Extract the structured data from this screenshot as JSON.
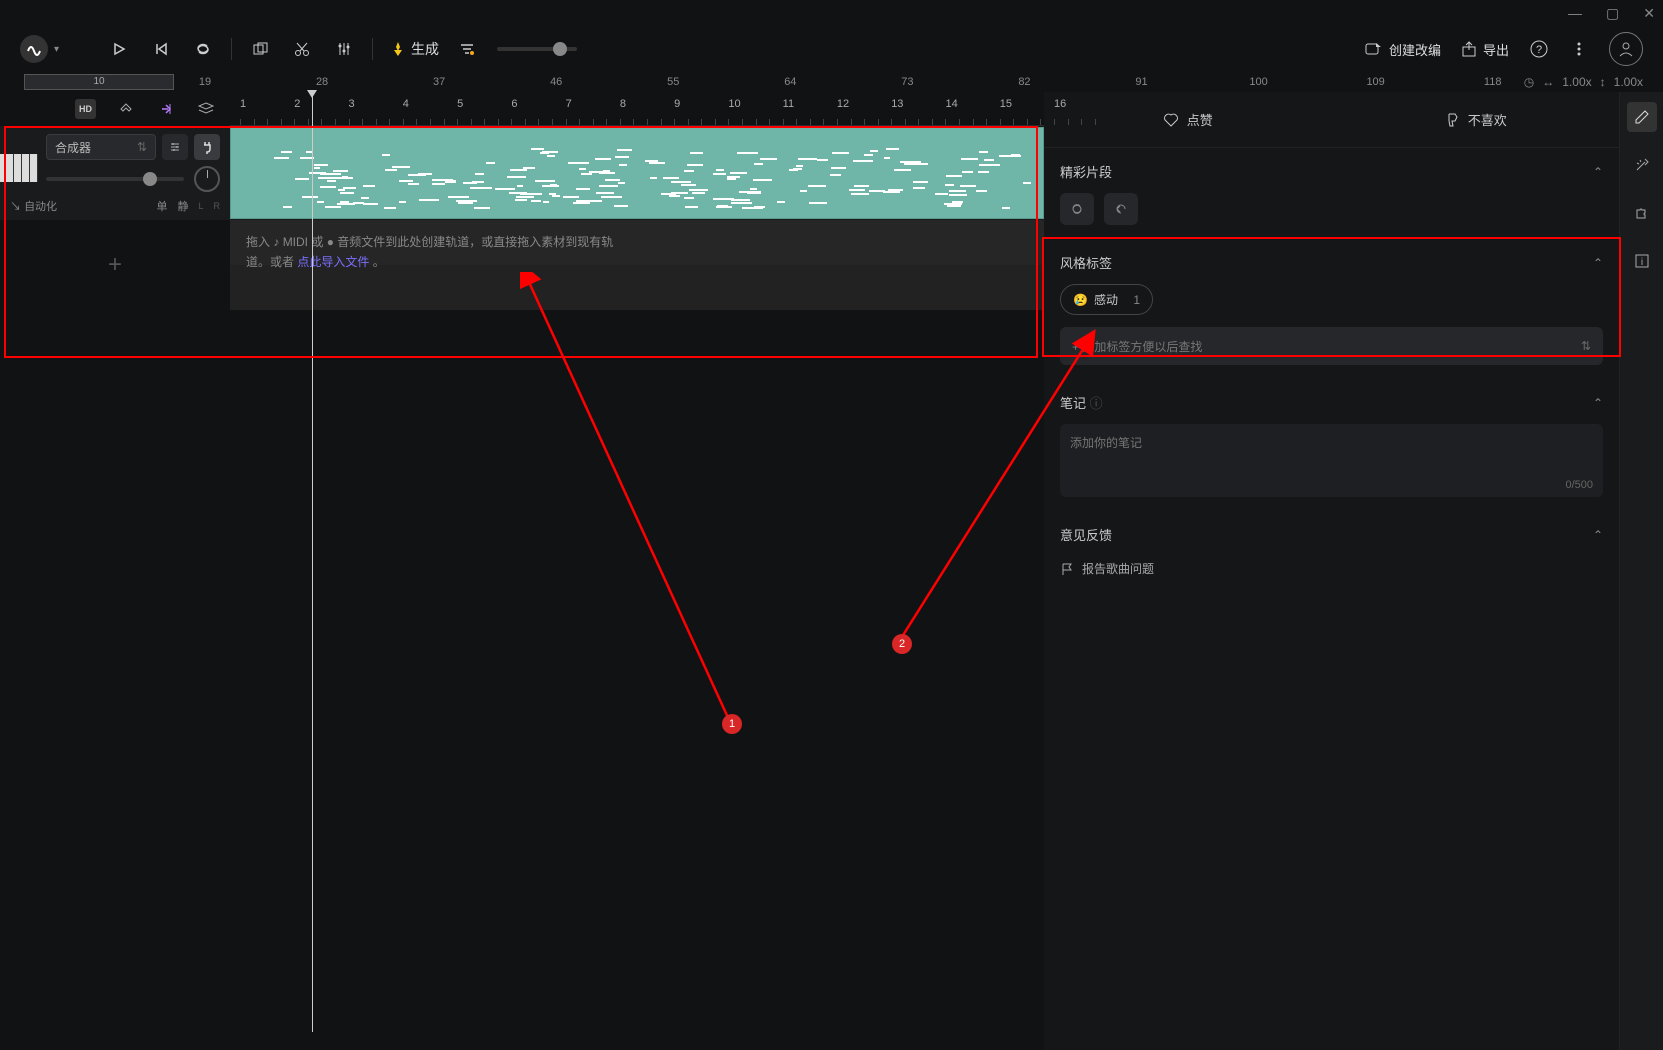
{
  "titlebar": {
    "minimize": "—",
    "maximize": "▢",
    "close": "✕"
  },
  "toolbar": {
    "generate_label": "生成",
    "create_edit": "创建改编",
    "export": "导出"
  },
  "ruler_top": {
    "start": "10",
    "numbers": [
      "19",
      "28",
      "37",
      "46",
      "55",
      "64",
      "73",
      "82",
      "91",
      "100",
      "109",
      "118"
    ]
  },
  "zoom": {
    "h": "1.00x",
    "v": "1.00x"
  },
  "ruler_marks": [
    "1",
    "2",
    "3",
    "4",
    "5",
    "6",
    "7",
    "8",
    "9",
    "10",
    "11",
    "12",
    "13",
    "14",
    "15",
    "16"
  ],
  "track": {
    "instrument": "合成器",
    "automation": "自动化",
    "solo": "单",
    "mute": "静",
    "lr_l": "L",
    "lr_r": "R"
  },
  "dropzone": {
    "prefix": "拖入 ",
    "midi": "MIDI",
    "or": " 或 ",
    "suffix1": " 音频文件到此处创建轨道，或直接拖入素材到现有轨",
    "line2_pre": "道。或者 ",
    "link": "点此导入文件",
    "line2_post": " 。"
  },
  "inspector": {
    "like": "点赞",
    "dislike": "不喜欢",
    "highlights": "精彩片段",
    "style_tags": "风格标签",
    "tag_emoji": "😢",
    "tag_label": "感动",
    "tag_count": "1",
    "add_tag_placeholder": "+ 添加标签方便以后查找",
    "notes": "笔记",
    "notes_placeholder": "添加你的笔记",
    "char_count": "0/500",
    "feedback": "意见反馈",
    "report": "报告歌曲问题"
  },
  "annotations": {
    "n1": "1",
    "n2": "2"
  }
}
